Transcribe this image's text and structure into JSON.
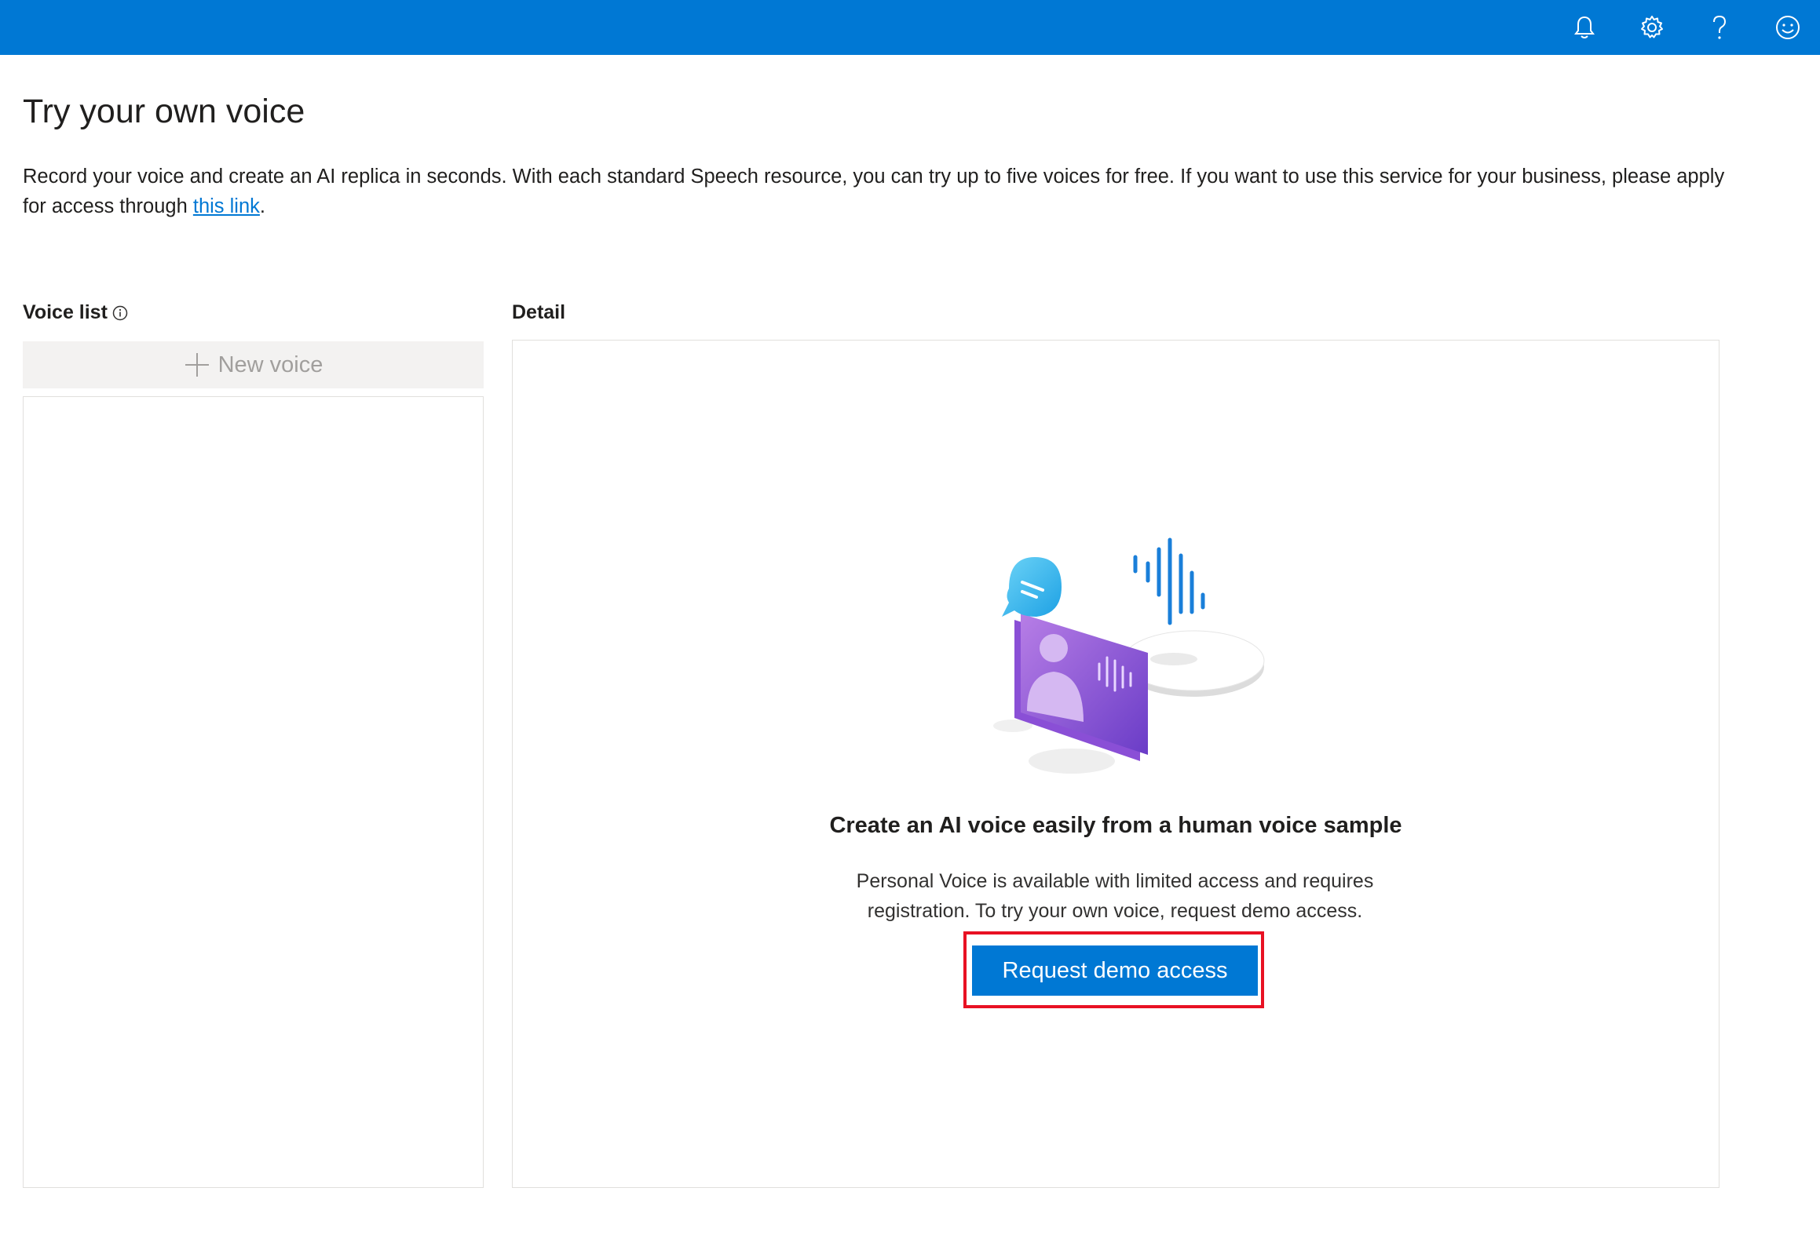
{
  "header": {
    "icons": [
      "bell-icon",
      "gear-icon",
      "help-icon",
      "smiley-icon"
    ],
    "brand_color": "#0078d4"
  },
  "page": {
    "title": "Try your own voice",
    "intro_text": "Record your voice and create an AI replica in seconds. With each standard Speech resource, you can try up to five voices for free. If you want to use this service for your business, please apply for access through ",
    "intro_link": "this link",
    "intro_end": "."
  },
  "voice_list": {
    "label": "Voice list",
    "new_voice_label": "New voice"
  },
  "detail": {
    "label": "Detail",
    "empty_title": "Create an AI voice easily from a human voice sample",
    "empty_desc_line1": "Personal Voice is available with limited access and requires",
    "empty_desc_line2": "registration. To try your own voice, request demo access.",
    "request_button_label": "Request demo access",
    "highlight_color": "#e81123"
  }
}
